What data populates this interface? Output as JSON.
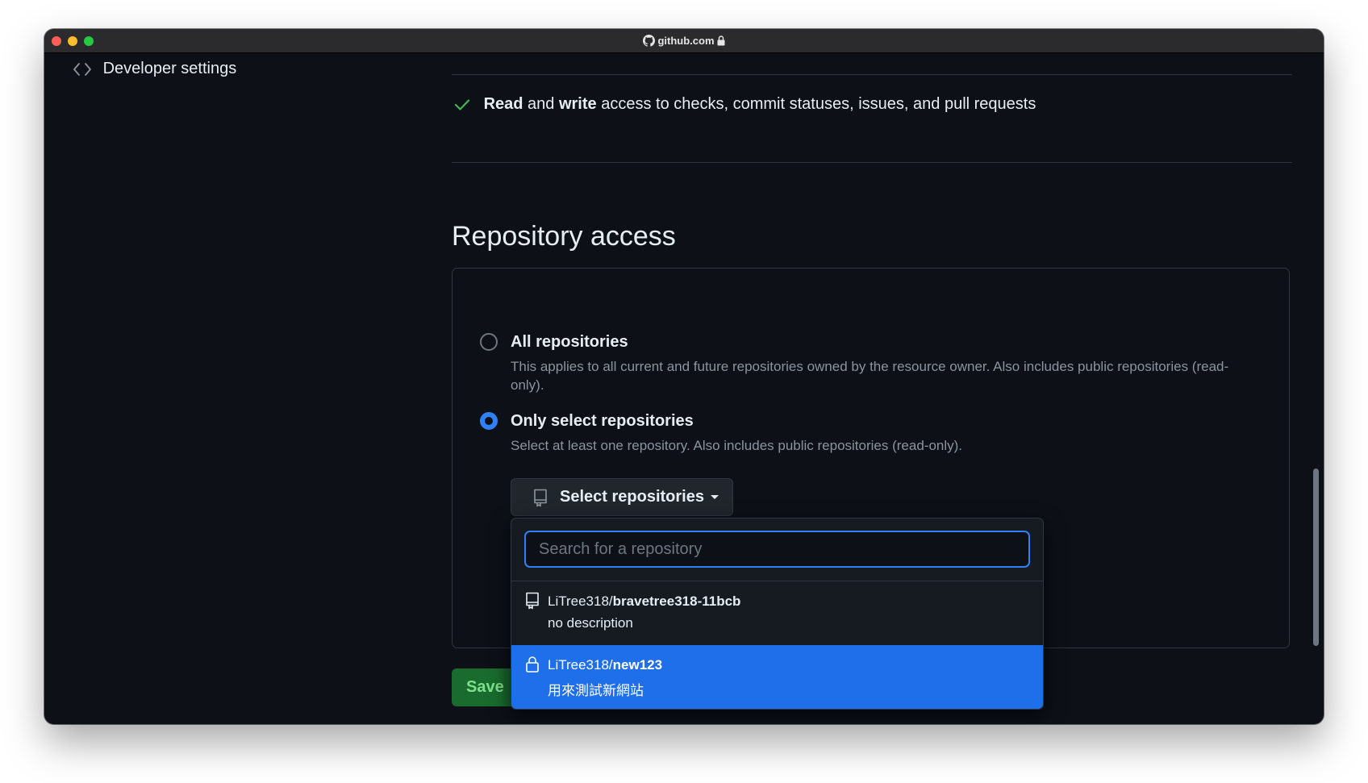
{
  "browser": {
    "url": "github.com"
  },
  "sidebar": {
    "developer_settings": "Developer settings"
  },
  "permission_summary": {
    "read_word": "Read",
    "and_word": "and",
    "write_word": "write",
    "rest": "access to checks, commit statuses, issues, and pull requests"
  },
  "repository_access": {
    "title": "Repository access",
    "options": [
      {
        "label": "All repositories",
        "description": "This applies to all current and future repositories owned by the resource owner. Also includes public repositories (read-only).",
        "selected": false
      },
      {
        "label": "Only select repositories",
        "description": "Select at least one repository. Also includes public repositories (read-only).",
        "selected": true
      }
    ],
    "select_button": "Select repositories"
  },
  "dropdown": {
    "search_placeholder": "Search for a repository",
    "search_value": "",
    "repos": [
      {
        "owner": "LiTree318/",
        "name": "bravetree318-11bcb",
        "description": "no description",
        "icon": "repo-icon",
        "active": false
      },
      {
        "owner": "LiTree318/",
        "name": "new123",
        "description": "用來測試新網站",
        "icon": "lock-icon",
        "active": true
      }
    ]
  },
  "actions": {
    "save": "Save"
  },
  "colors": {
    "background": "#0d1117",
    "accent": "#1f6feb",
    "save_green": "#196c2e"
  }
}
